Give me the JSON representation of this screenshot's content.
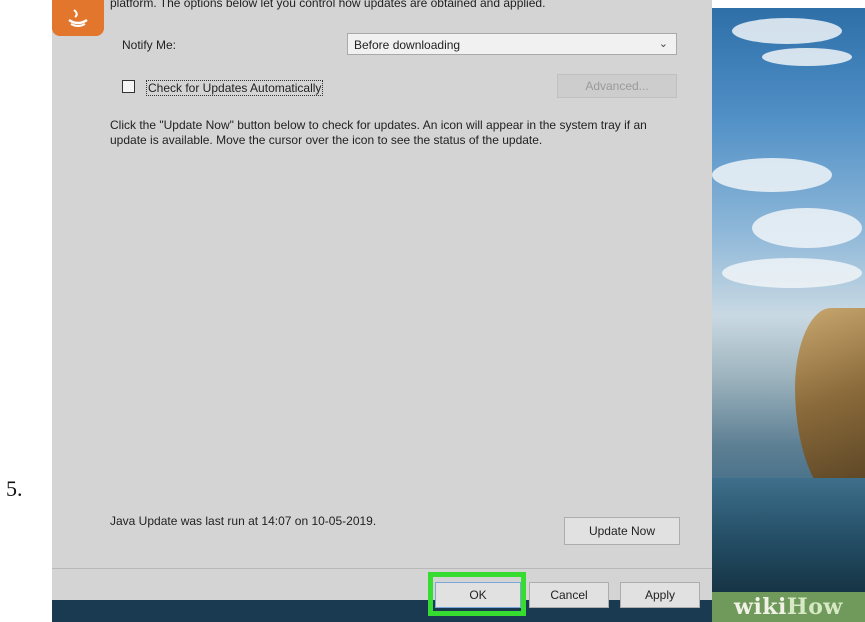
{
  "step_number": "5.",
  "dialog": {
    "intro_text": "platform. The options below let you control how updates are obtained and applied.",
    "notify_label": "Notify Me:",
    "notify_value": "Before downloading",
    "check_auto_label": "Check for Updates Automatically",
    "check_auto_checked": false,
    "advanced_label": "Advanced...",
    "description": "Click the \"Update Now\" button below to check for updates. An icon will appear in the system tray if an update is available. Move the cursor over the icon to see the status of the update.",
    "last_run": "Java Update was last run at 14:07 on 10-05-2019.",
    "update_now_label": "Update Now",
    "ok_label": "OK",
    "cancel_label": "Cancel",
    "apply_label": "Apply"
  },
  "watermark": {
    "text_wiki": "wiki",
    "text_how": "How"
  },
  "colors": {
    "highlight": "#36dc2f",
    "dialog_bg": "#d4d4d4",
    "java_orange": "#e2762c"
  },
  "icons": [
    "java-logo-icon",
    "chevron-down-icon"
  ]
}
